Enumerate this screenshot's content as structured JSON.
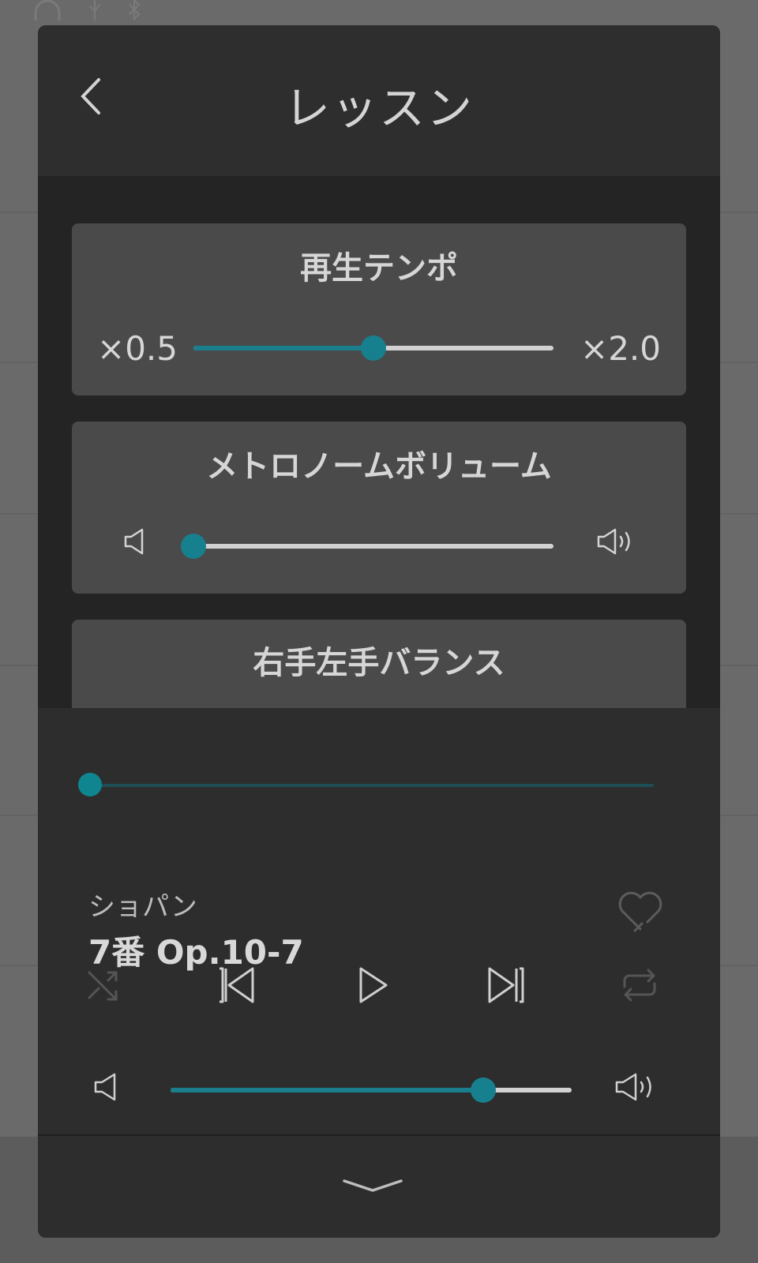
{
  "app": {
    "title": "レッスン"
  },
  "cards": {
    "tempo": {
      "title": "再生テンポ",
      "min_label": "×0.5",
      "max_label": "×2.0",
      "value_fraction": 0.5
    },
    "metronome": {
      "title": "メトロノームボリューム",
      "value_fraction": 0.0
    },
    "balance": {
      "title": "右手左手バランス"
    }
  },
  "player": {
    "artist": "ショパン",
    "song": "7番 Op.10-7",
    "progress_fraction": 0.0,
    "volume_fraction": 0.78,
    "favorite": false
  },
  "colors": {
    "accent": "#17808e",
    "card_bg": "#4a4a4a",
    "modal_bg": "#2d2d2d",
    "text": "#d6d6d6"
  },
  "icons": {
    "back": "chevron-left-icon",
    "volume_low": "speaker-low-icon",
    "volume_high": "speaker-high-icon",
    "favorite": "heart-outline-icon",
    "shuffle": "shuffle-icon",
    "previous": "skip-previous-icon",
    "play": "play-icon",
    "next": "skip-next-icon",
    "repeat": "repeat-icon",
    "collapse": "chevron-down-icon"
  }
}
